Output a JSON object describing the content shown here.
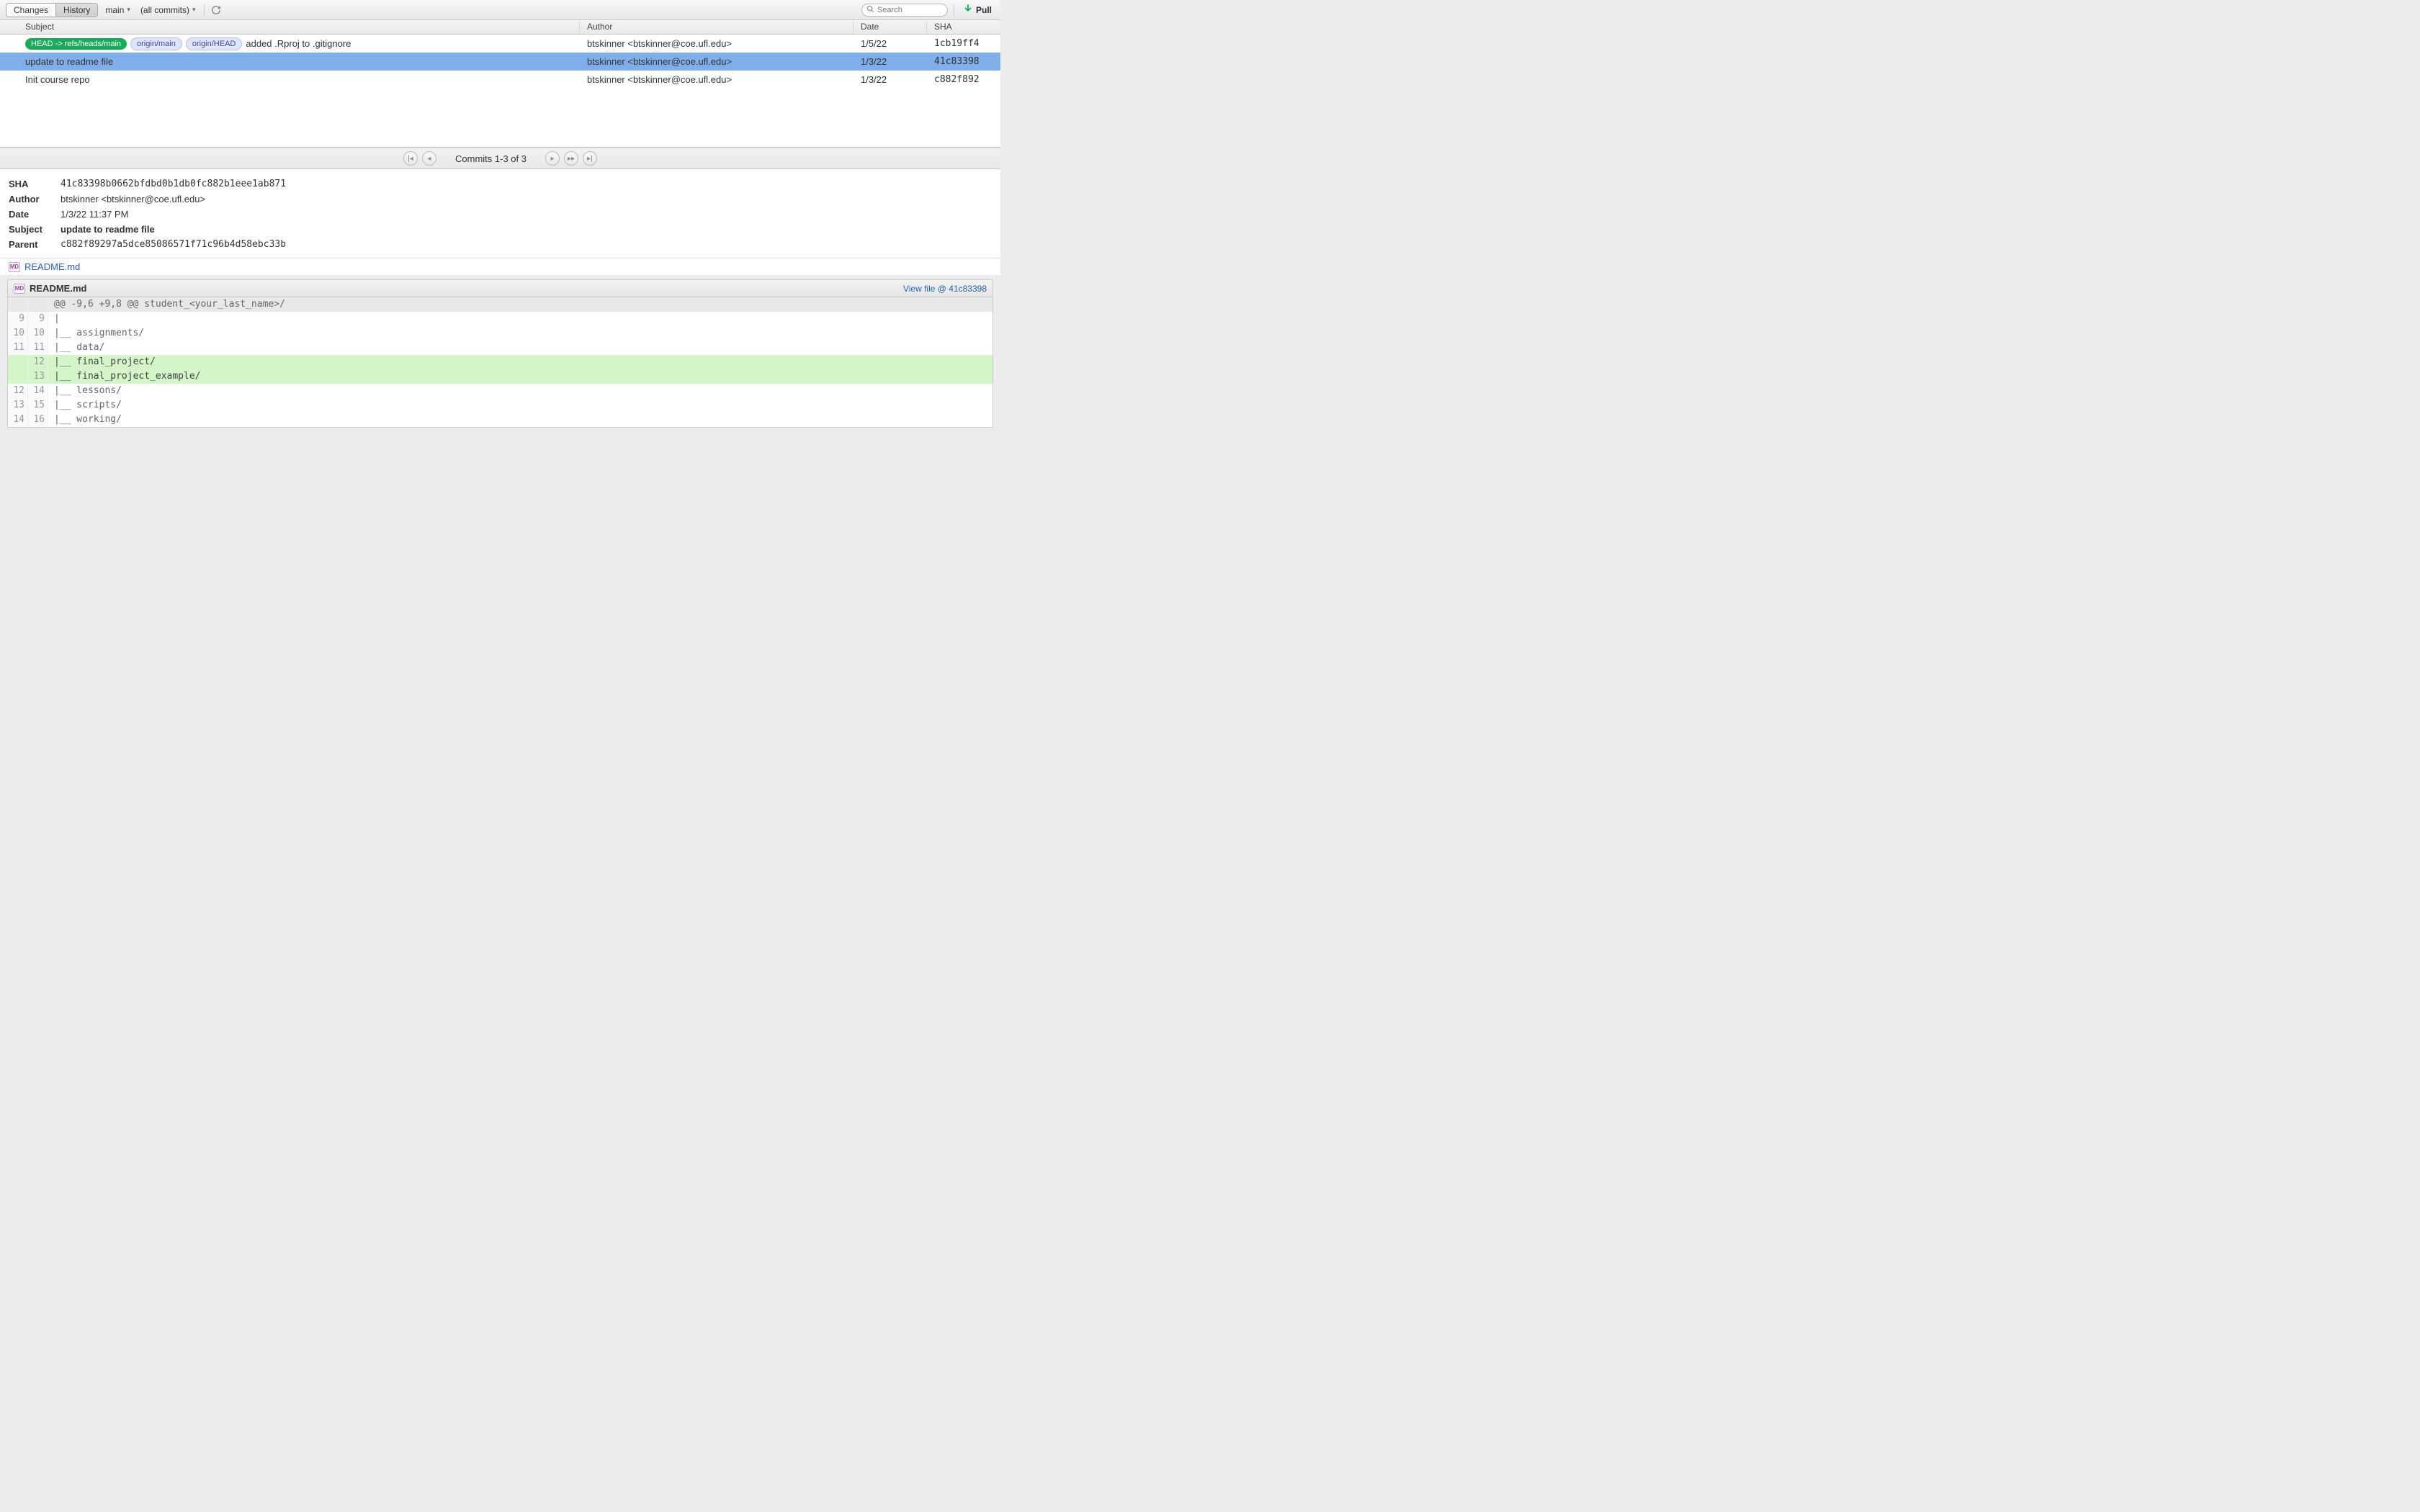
{
  "toolbar": {
    "changes_label": "Changes",
    "history_label": "History",
    "branch": "main",
    "filter": "(all commits)",
    "search_placeholder": "Search",
    "pull_label": "Pull"
  },
  "columns": {
    "subject": "Subject",
    "author": "Author",
    "date": "Date",
    "sha": "SHA"
  },
  "refs": {
    "head": "HEAD -> refs/heads/main",
    "origin_main": "origin/main",
    "origin_head": "origin/HEAD"
  },
  "commits": [
    {
      "subject": "added .Rproj to .gitignore",
      "author": "btskinner <btskinner@coe.ufl.edu>",
      "date": "1/5/22",
      "sha": "1cb19ff4",
      "has_refs": true
    },
    {
      "subject": "update to readme file",
      "author": "btskinner <btskinner@coe.ufl.edu>",
      "date": "1/3/22",
      "sha": "41c83398",
      "selected": true
    },
    {
      "subject": "Init course repo",
      "author": "btskinner <btskinner@coe.ufl.edu>",
      "date": "1/3/22",
      "sha": "c882f892"
    }
  ],
  "pager": {
    "text": "Commits 1-3 of 3"
  },
  "detail": {
    "sha_label": "SHA",
    "sha": "41c83398b0662bfdbd0b1db0fc882b1eee1ab871",
    "author_label": "Author",
    "author": "btskinner <btskinner@coe.ufl.edu>",
    "date_label": "Date",
    "date": "1/3/22 11:37 PM",
    "subject_label": "Subject",
    "subject": "update to readme file",
    "parent_label": "Parent",
    "parent": "c882f89297a5dce85086571f71c96b4d58ebc33b"
  },
  "file": {
    "name": "README.md",
    "view_link": "View file @ 41c83398"
  },
  "diff": {
    "hunk": "@@ -9,6 +9,8 @@ student_<your_last_name>/",
    "lines": [
      {
        "old": "9",
        "new": "9",
        "type": "ctx",
        "text": "|"
      },
      {
        "old": "10",
        "new": "10",
        "type": "ctx",
        "text": "|__ assignments/"
      },
      {
        "old": "11",
        "new": "11",
        "type": "ctx",
        "text": "|__ data/"
      },
      {
        "old": "",
        "new": "12",
        "type": "add",
        "text": "|__ final_project/"
      },
      {
        "old": "",
        "new": "13",
        "type": "add",
        "text": "|__ final_project_example/"
      },
      {
        "old": "12",
        "new": "14",
        "type": "ctx",
        "text": "|__ lessons/"
      },
      {
        "old": "13",
        "new": "15",
        "type": "ctx",
        "text": "|__ scripts/"
      },
      {
        "old": "14",
        "new": "16",
        "type": "ctx",
        "text": "|__ working/"
      }
    ]
  }
}
